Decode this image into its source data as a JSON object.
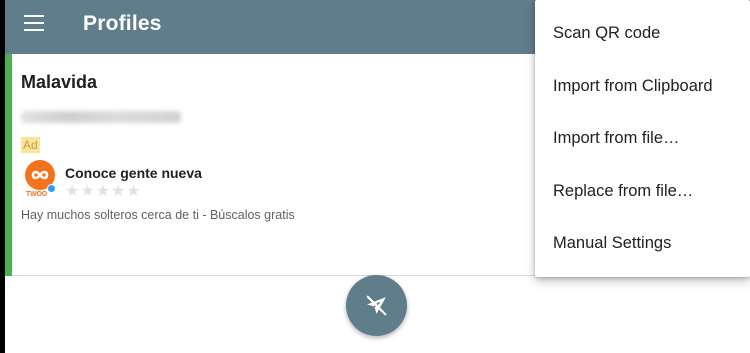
{
  "appbar": {
    "title": "Profiles",
    "menu_icon": "hamburger-menu-icon"
  },
  "colors": {
    "appbar": "#607d8b",
    "accent": "#4caf50",
    "fab": "#607d8b"
  },
  "profile": {
    "name": "Malavida"
  },
  "ad": {
    "badge": "Ad",
    "app_name": "Conoce gente nueva",
    "icon_brand": "TWOO",
    "stars": "★★★★★",
    "description": "Hay muchos solteros cerca de ti - Búscalos gratis"
  },
  "fab": {
    "icon": "airplane-off-icon"
  },
  "menu": {
    "items": [
      {
        "label": "Scan QR code"
      },
      {
        "label": "Import from Clipboard"
      },
      {
        "label": "Import from file…"
      },
      {
        "label": "Replace from file…"
      },
      {
        "label": "Manual Settings"
      }
    ]
  }
}
